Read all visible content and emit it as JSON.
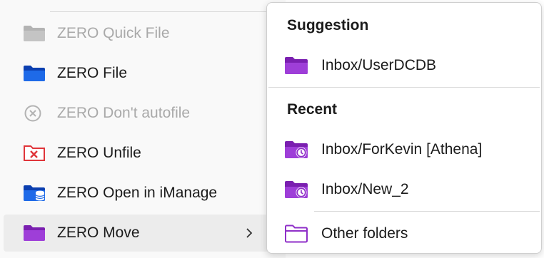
{
  "menu": {
    "items": [
      {
        "label": "ZERO Quick File",
        "icon": "gray-folder-icon",
        "state": "disabled"
      },
      {
        "label": "ZERO File",
        "icon": "blue-folder-icon",
        "state": "enabled"
      },
      {
        "label": "ZERO Don't autofile",
        "icon": "circle-x-icon",
        "state": "disabled"
      },
      {
        "label": "ZERO Unfile",
        "icon": "red-unfile-icon",
        "state": "enabled"
      },
      {
        "label": "ZERO Open in iManage",
        "icon": "imanage-db-icon",
        "state": "enabled"
      },
      {
        "label": "ZERO Move",
        "icon": "purple-folder-icon",
        "state": "hovered",
        "has_submenu": true
      }
    ]
  },
  "submenu": {
    "suggestion_title": "Suggestion",
    "suggestion_items": [
      {
        "label": "Inbox/UserDCDB",
        "icon": "purple-folder-icon"
      }
    ],
    "recent_title": "Recent",
    "recent_items": [
      {
        "label": "Inbox/ForKevin [Athena]",
        "icon": "recent-folder-icon"
      },
      {
        "label": "Inbox/New_2",
        "icon": "recent-folder-icon"
      }
    ],
    "other_label": "Other folders",
    "other_icon": "outline-folder-icon"
  },
  "colors": {
    "accent_purple": "#8f2fc8",
    "blue": "#1857d8",
    "red": "#e0353a",
    "disabled_gray": "#a9a9a9",
    "hover_bg": "#ececec"
  }
}
